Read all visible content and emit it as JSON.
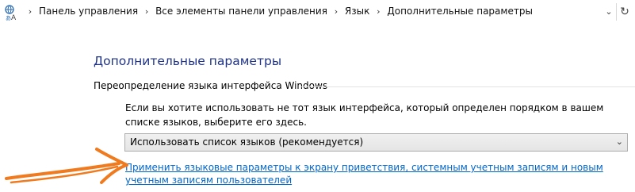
{
  "address_bar": {
    "breadcrumbs": [
      "Панель управления",
      "Все элементы панели управления",
      "Язык",
      "Дополнительные параметры"
    ],
    "dropdown_icon": "chevron-down-icon",
    "refresh_icon": "refresh-icon",
    "location_icon": "language-control-panel-icon"
  },
  "main": {
    "title": "Дополнительные параметры",
    "section_heading": "Переопределение языка интерфейса Windows",
    "description": "Если вы хотите использовать не тот язык интерфейса, который определен порядком в вашем списке языков, выберите его здесь.",
    "language_select": {
      "selected": "Использовать список языков (рекомендуется)"
    },
    "apply_link": "Применить языковые параметры к экрану приветствия, системным учетным записям и новым учетным записям пользователей"
  },
  "colors": {
    "title": "#1e3287",
    "link": "#0066cc",
    "annotation_arrow": "#f07a1e"
  }
}
